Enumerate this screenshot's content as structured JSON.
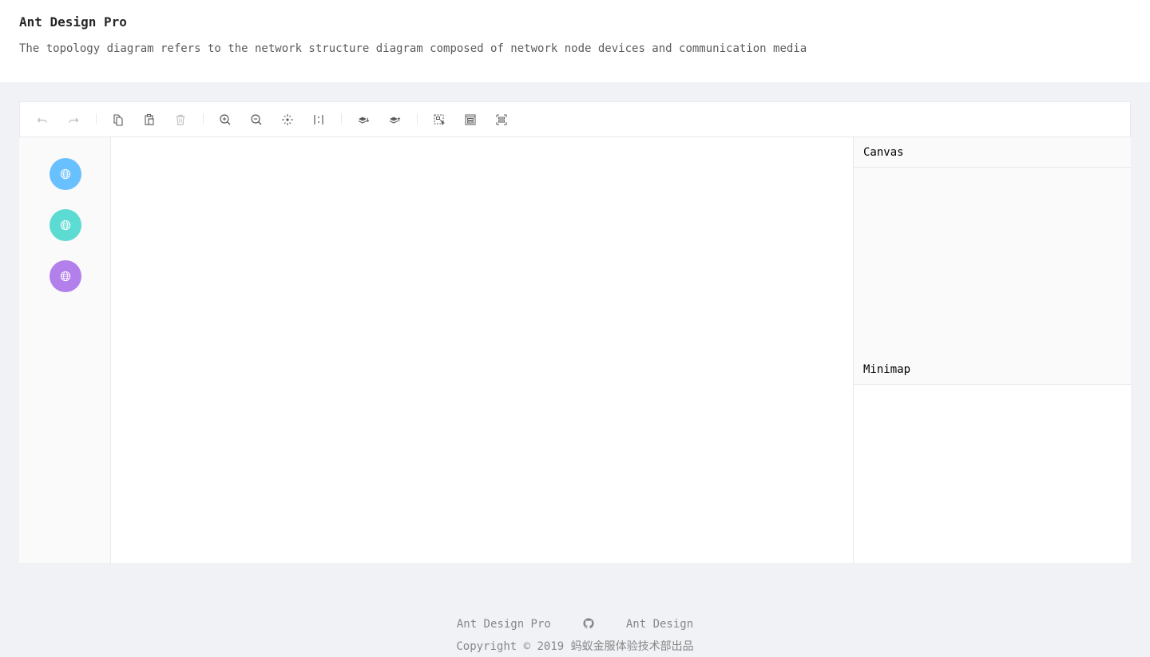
{
  "header": {
    "title": "Ant Design Pro",
    "description": "The topology diagram refers to the network structure diagram composed of network node devices and communication media"
  },
  "toolbar": {
    "items": [
      {
        "name": "undo-icon",
        "label": "Undo"
      },
      {
        "name": "redo-icon",
        "label": "Redo"
      },
      {
        "name": "copy-icon",
        "label": "Copy"
      },
      {
        "name": "paste-icon",
        "label": "Paste"
      },
      {
        "name": "delete-icon",
        "label": "Delete"
      },
      {
        "name": "zoom-in-icon",
        "label": "Zoom In"
      },
      {
        "name": "zoom-out-icon",
        "label": "Zoom Out"
      },
      {
        "name": "auto-fit-icon",
        "label": "Fit Map"
      },
      {
        "name": "actual-size-icon",
        "label": "Actual Size"
      },
      {
        "name": "to-back-icon",
        "label": "To Back"
      },
      {
        "name": "to-front-icon",
        "label": "To Front"
      },
      {
        "name": "multi-select-icon",
        "label": "Multiselect"
      },
      {
        "name": "add-group-icon",
        "label": "Add Group"
      },
      {
        "name": "ungroup-icon",
        "label": "Ungroup"
      }
    ]
  },
  "item_panel": {
    "nodes": [
      {
        "name": "network-node-blue",
        "color": "#69c0ff",
        "icon": "globe-icon"
      },
      {
        "name": "network-node-cyan",
        "color": "#5cdbd3",
        "icon": "globe-icon"
      },
      {
        "name": "network-node-purple",
        "color": "#b37feb",
        "icon": "globe-icon"
      }
    ]
  },
  "detail_panel": {
    "canvas_title": "Canvas",
    "minimap_title": "Minimap"
  },
  "footer": {
    "links": [
      "Ant Design Pro",
      "github-icon",
      "Ant Design"
    ],
    "link_pro": "Ant Design Pro",
    "link_antd": "Ant Design",
    "copyright": "Copyright © 2019 蚂蚁金服体验技术部出品"
  },
  "colors": {
    "page_bg": "#f0f2f5",
    "border": "#e6e9ed",
    "icon_active": "#595959",
    "icon_disabled": "#bfbfbf"
  }
}
